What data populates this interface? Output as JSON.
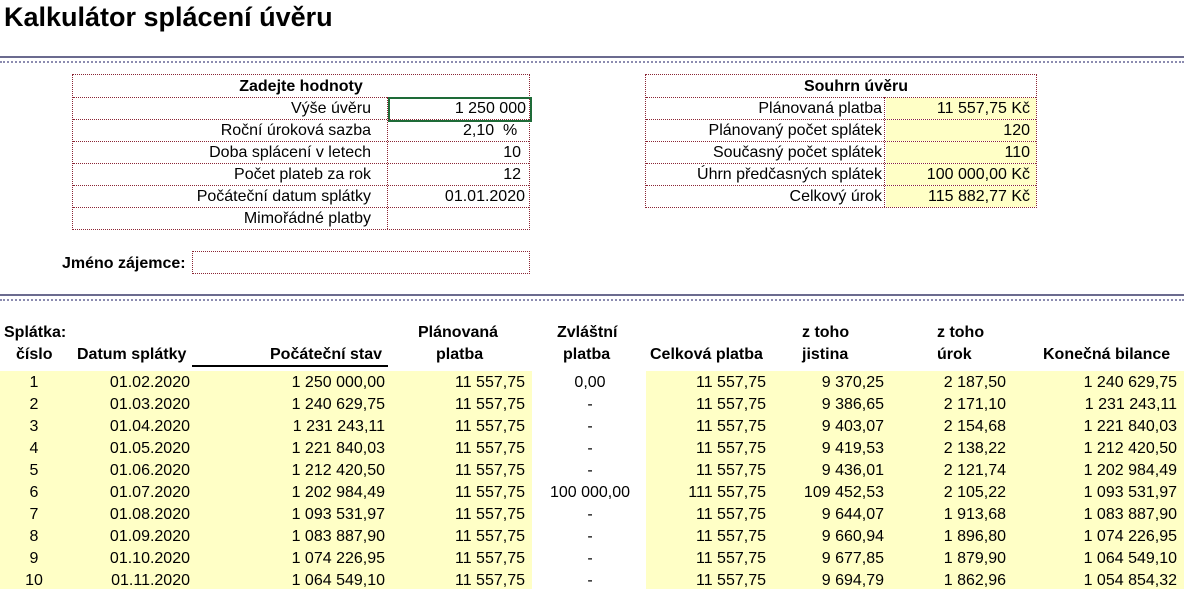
{
  "title": "Kalkulátor splácení úvěru",
  "inputs": {
    "heading": "Zadejte hodnoty",
    "rows": [
      {
        "label": "Výše úvěru",
        "value": "1 250 000"
      },
      {
        "label": "Roční úroková sazba",
        "value": "2,10  %"
      },
      {
        "label": "Doba splácení v letech",
        "value": "10"
      },
      {
        "label": "Počet plateb za rok",
        "value": "12"
      },
      {
        "label": "Počáteční datum splátky",
        "value": "01.01.2020"
      },
      {
        "label": "Mimořádné platby",
        "value": ""
      }
    ]
  },
  "summary": {
    "heading": "Souhrn úvěru",
    "rows": [
      {
        "label": "Plánovaná platba",
        "value": "11 557,75 Kč"
      },
      {
        "label": "Plánovaný počet splátek",
        "value": "120"
      },
      {
        "label": "Současný počet splátek",
        "value": "110"
      },
      {
        "label": "Úhrn předčasných splátek",
        "value": "100 000,00 Kč"
      },
      {
        "label": "Celkový úrok",
        "value": "115 882,77 Kč"
      }
    ]
  },
  "customer": {
    "label": "Jméno zájemce:",
    "value": ""
  },
  "table": {
    "headers": {
      "num_top": "Splátka:",
      "num_bottom": "číslo",
      "date": "Datum splátky",
      "start": "Počáteční stav",
      "planned_top": "Plánovaná",
      "planned_bottom": "platba",
      "extra_top": "Zvláštní",
      "extra_bottom": "platba",
      "total": "Celková platba",
      "principal_top": "z toho",
      "principal_bottom": "jistina",
      "interest_top": "z toho",
      "interest_bottom": "úrok",
      "end": "Konečná bilance"
    },
    "rows": [
      {
        "num": "1",
        "date": "01.02.2020",
        "start": "1 250 000,00",
        "planned": "11 557,75",
        "extra": "0,00",
        "total": "11 557,75",
        "principal": "9 370,25",
        "interest": "2 187,50",
        "end": "1 240 629,75"
      },
      {
        "num": "2",
        "date": "01.03.2020",
        "start": "1 240 629,75",
        "planned": "11 557,75",
        "extra": "-",
        "total": "11 557,75",
        "principal": "9 386,65",
        "interest": "2 171,10",
        "end": "1 231 243,11"
      },
      {
        "num": "3",
        "date": "01.04.2020",
        "start": "1 231 243,11",
        "planned": "11 557,75",
        "extra": "-",
        "total": "11 557,75",
        "principal": "9 403,07",
        "interest": "2 154,68",
        "end": "1 221 840,03"
      },
      {
        "num": "4",
        "date": "01.05.2020",
        "start": "1 221 840,03",
        "planned": "11 557,75",
        "extra": "-",
        "total": "11 557,75",
        "principal": "9 419,53",
        "interest": "2 138,22",
        "end": "1 212 420,50"
      },
      {
        "num": "5",
        "date": "01.06.2020",
        "start": "1 212 420,50",
        "planned": "11 557,75",
        "extra": "-",
        "total": "11 557,75",
        "principal": "9 436,01",
        "interest": "2 121,74",
        "end": "1 202 984,49"
      },
      {
        "num": "6",
        "date": "01.07.2020",
        "start": "1 202 984,49",
        "planned": "11 557,75",
        "extra": "100 000,00",
        "total": "111 557,75",
        "principal": "109 452,53",
        "interest": "2 105,22",
        "end": "1 093 531,97"
      },
      {
        "num": "7",
        "date": "01.08.2020",
        "start": "1 093 531,97",
        "planned": "11 557,75",
        "extra": "-",
        "total": "11 557,75",
        "principal": "9 644,07",
        "interest": "1 913,68",
        "end": "1 083 887,90"
      },
      {
        "num": "8",
        "date": "01.09.2020",
        "start": "1 083 887,90",
        "planned": "11 557,75",
        "extra": "-",
        "total": "11 557,75",
        "principal": "9 660,94",
        "interest": "1 896,80",
        "end": "1 074 226,95"
      },
      {
        "num": "9",
        "date": "01.10.2020",
        "start": "1 074 226,95",
        "planned": "11 557,75",
        "extra": "-",
        "total": "11 557,75",
        "principal": "9 677,85",
        "interest": "1 879,90",
        "end": "1 064 549,10"
      },
      {
        "num": "10",
        "date": "01.11.2020",
        "start": "1 064 549,10",
        "planned": "11 557,75",
        "extra": "-",
        "total": "11 557,75",
        "principal": "9 694,79",
        "interest": "1 862,96",
        "end": "1 054 854,32"
      }
    ]
  },
  "colors": {
    "yellow": "#ffffc6",
    "rule": "#6b6b8f",
    "dotted_border": "#8b2635",
    "selection": "#1e6b38"
  }
}
